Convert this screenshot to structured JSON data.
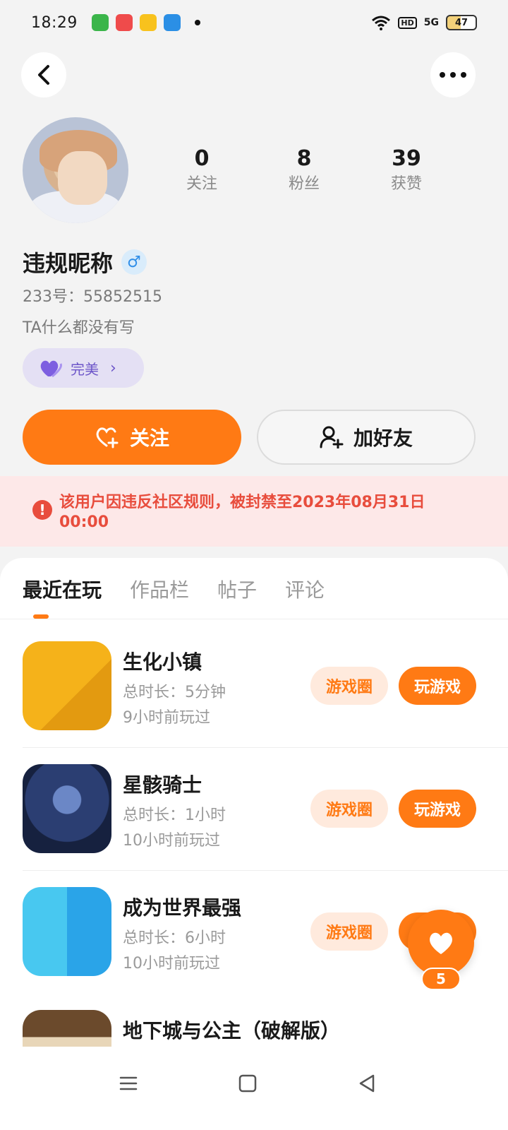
{
  "status_bar": {
    "time": "18:29",
    "network": "5G",
    "hd": "HD",
    "battery": "47"
  },
  "profile": {
    "stats": [
      {
        "value": "0",
        "label": "关注"
      },
      {
        "value": "8",
        "label": "粉丝"
      },
      {
        "value": "39",
        "label": "获赞"
      }
    ],
    "nickname": "违规昵称",
    "gender_symbol": "♂",
    "uid": "233号：55852515",
    "bio": "TA什么都没有写",
    "badge_label": "完美"
  },
  "actions": {
    "follow_label": "关注",
    "add_friend_label": "加好友"
  },
  "ban_notice": {
    "text": "该用户因违反社区规则，被封禁至2023年08月31日 00:00"
  },
  "tabs": [
    "最近在玩",
    "作品栏",
    "帖子",
    "评论"
  ],
  "games": [
    {
      "name": "生化小镇",
      "duration": "总时长：5分钟",
      "last_played": "9小时前玩过",
      "circle_label": "游戏圈",
      "play_label": "玩游戏"
    },
    {
      "name": "星骸骑士",
      "duration": "总时长：1小时",
      "last_played": "10小时前玩过",
      "circle_label": "游戏圈",
      "play_label": "玩游戏"
    },
    {
      "name": "成为世界最强",
      "duration": "总时长：6小时",
      "last_played": "10小时前玩过",
      "circle_label": "游戏圈",
      "play_label": "玩游戏"
    },
    {
      "name": "地下城与公主（破解版）"
    }
  ],
  "floating_like": {
    "count": "5"
  },
  "colors": {
    "accent": "#ff7a14",
    "ban_text": "#e84d3d",
    "ban_bg": "#fde8e8",
    "badge": "#6d56c9"
  }
}
